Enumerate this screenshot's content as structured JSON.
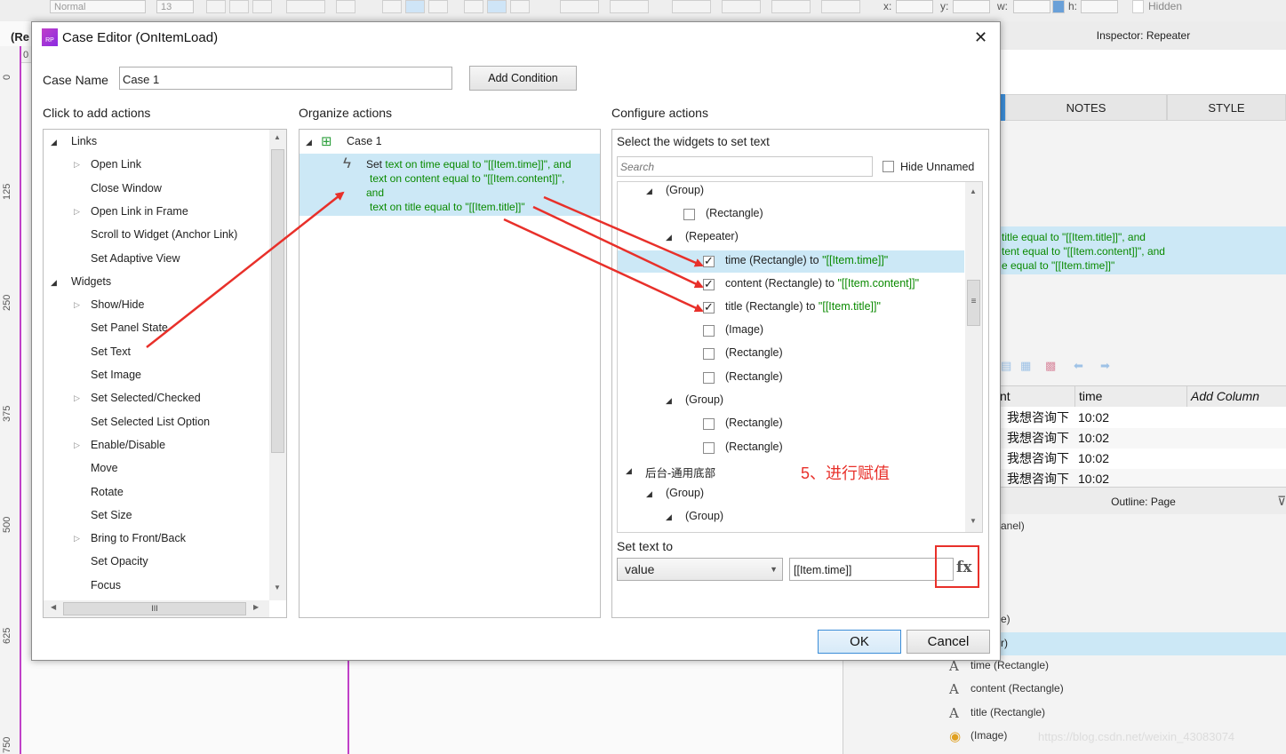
{
  "toolbar": {
    "style_value": "Normal",
    "size_value": "13",
    "x_label": "x:",
    "y_label": "y:",
    "w_label": "w:",
    "h_label": "h:",
    "hidden_label": "Hidden"
  },
  "canvas": {
    "page_tab_partial": "(Re",
    "ruler_top_zero": "0",
    "ruler_marks": [
      "0",
      "125",
      "250",
      "375",
      "500",
      "625",
      "750"
    ]
  },
  "inspector": {
    "title": "Inspector: Repeater",
    "tabs": [
      "NOTES",
      "STYLE"
    ],
    "interaction_preview": [
      "title equal to \"[[Item.title]]\", and",
      "tent equal to \"[[Item.content]]\", and",
      "e equal to \"[[Item.time]]\""
    ],
    "grid_headers": [
      "nt",
      "time",
      "Add Column"
    ],
    "grid_rows": [
      {
        "content": "我想咨询下",
        "time": "10:02"
      },
      {
        "content": "我想咨询下",
        "time": "10:02"
      },
      {
        "content": "我想咨询下",
        "time": "10:02"
      },
      {
        "content": "我想咨询下",
        "time": "10:02"
      }
    ],
    "outline_title": "Outline: Page",
    "outline_partial": [
      "anel)",
      "e)",
      "r)"
    ],
    "outline_items": [
      {
        "label": "time (Rectangle)"
      },
      {
        "label": "content (Rectangle)"
      },
      {
        "label": "title (Rectangle)"
      },
      {
        "label": "(Image)"
      }
    ],
    "watermark": "https://blog.csdn.net/weixin_43083074"
  },
  "dialog": {
    "title": "Case Editor (OnItemLoad)",
    "case_name_label": "Case Name",
    "case_name_value": "Case 1",
    "add_condition_label": "Add Condition",
    "click_to_add_label": "Click to add actions",
    "organize_label": "Organize actions",
    "configure_label": "Configure actions",
    "actions_tree": [
      {
        "label": "Links",
        "level": 0,
        "expander": "open"
      },
      {
        "label": "Open Link",
        "level": 1,
        "expander": "closed"
      },
      {
        "label": "Close Window",
        "level": 1,
        "expander": "none"
      },
      {
        "label": "Open Link in Frame",
        "level": 1,
        "expander": "closed"
      },
      {
        "label": "Scroll to Widget (Anchor Link)",
        "level": 1,
        "expander": "none"
      },
      {
        "label": "Set Adaptive View",
        "level": 1,
        "expander": "none"
      },
      {
        "label": "Widgets",
        "level": 0,
        "expander": "open"
      },
      {
        "label": "Show/Hide",
        "level": 1,
        "expander": "closed"
      },
      {
        "label": "Set Panel State",
        "level": 1,
        "expander": "none"
      },
      {
        "label": "Set Text",
        "level": 1,
        "expander": "none"
      },
      {
        "label": "Set Image",
        "level": 1,
        "expander": "none"
      },
      {
        "label": "Set Selected/Checked",
        "level": 1,
        "expander": "closed"
      },
      {
        "label": "Set Selected List Option",
        "level": 1,
        "expander": "none"
      },
      {
        "label": "Enable/Disable",
        "level": 1,
        "expander": "closed"
      },
      {
        "label": "Move",
        "level": 1,
        "expander": "none"
      },
      {
        "label": "Rotate",
        "level": 1,
        "expander": "none"
      },
      {
        "label": "Set Size",
        "level": 1,
        "expander": "none"
      },
      {
        "label": "Bring to Front/Back",
        "level": 1,
        "expander": "closed"
      },
      {
        "label": "Set Opacity",
        "level": 1,
        "expander": "none"
      },
      {
        "label": "Focus",
        "level": 1,
        "expander": "none"
      }
    ],
    "hscroll_grip": "III",
    "organize": {
      "case_label": "Case 1",
      "action_lines": [
        {
          "prefix": "Set ",
          "rest": "text on time equal to \"[[Item.time]]\", and"
        },
        {
          "prefix": "",
          "rest": "text on content equal to \"[[Item.content]]\","
        },
        {
          "prefix": "",
          "rest": "and"
        },
        {
          "prefix": "",
          "rest": "text on title equal to \"[[Item.title]]\""
        }
      ]
    },
    "configure": {
      "select_label": "Select the widgets to set text",
      "search_placeholder": "Search",
      "hide_unnamed_label": "Hide Unnamed",
      "widgets": [
        {
          "label": "(Group)",
          "expander": true,
          "checkbox": false,
          "checked": false,
          "assign": ""
        },
        {
          "label": "(Rectangle)",
          "expander": false,
          "checkbox": true,
          "checked": false,
          "assign": ""
        },
        {
          "label": "(Repeater)",
          "expander": true,
          "checkbox": false,
          "checked": false,
          "assign": ""
        },
        {
          "label": "time (Rectangle) to ",
          "expander": false,
          "checkbox": true,
          "checked": true,
          "assign": "\"[[Item.time]]\""
        },
        {
          "label": "content (Rectangle) to ",
          "expander": false,
          "checkbox": true,
          "checked": true,
          "assign": "\"[[Item.content]]\""
        },
        {
          "label": "title (Rectangle) to ",
          "expander": false,
          "checkbox": true,
          "checked": true,
          "assign": "\"[[Item.title]]\""
        },
        {
          "label": "(Image)",
          "expander": false,
          "checkbox": true,
          "checked": false,
          "assign": ""
        },
        {
          "label": "(Rectangle)",
          "expander": false,
          "checkbox": true,
          "checked": false,
          "assign": ""
        },
        {
          "label": "(Rectangle)",
          "expander": false,
          "checkbox": true,
          "checked": false,
          "assign": ""
        },
        {
          "label": "(Group)",
          "expander": true,
          "checkbox": false,
          "checked": false,
          "assign": ""
        },
        {
          "label": "(Rectangle)",
          "expander": false,
          "checkbox": true,
          "checked": false,
          "assign": ""
        },
        {
          "label": "(Rectangle)",
          "expander": false,
          "checkbox": true,
          "checked": false,
          "assign": ""
        },
        {
          "label": "后台-通用底部",
          "expander": true,
          "checkbox": false,
          "checked": false,
          "assign": ""
        },
        {
          "label": "(Group)",
          "expander": true,
          "checkbox": false,
          "checked": false,
          "assign": ""
        },
        {
          "label": "(Group)",
          "expander": true,
          "checkbox": false,
          "checked": false,
          "assign": ""
        }
      ],
      "annotation": "5、进行赋值",
      "set_text_to_label": "Set text to",
      "type_value": "value",
      "value_input": "[[Item.time]]",
      "fx_label": "fx"
    },
    "ok_label": "OK",
    "cancel_label": "Cancel",
    "close_glyph": "✕"
  },
  "colors": {
    "selection_blue": "#cce8f6",
    "green_text": "#0a8a00",
    "annotation_red": "#e8302a",
    "arrow_red": "#e8302a"
  }
}
